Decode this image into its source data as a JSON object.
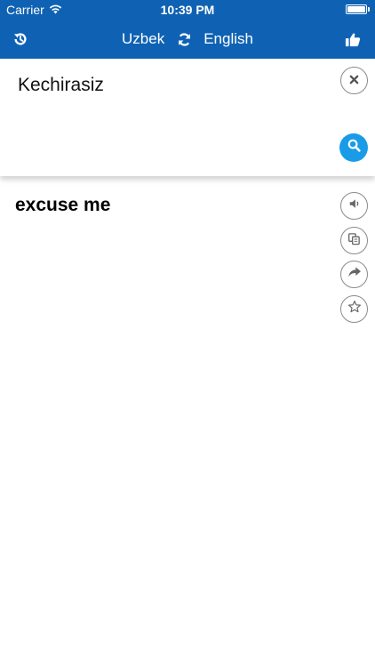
{
  "status_bar": {
    "carrier": "Carrier",
    "time": "10:39 PM",
    "icons": [
      "wifi-icon",
      "battery-icon"
    ]
  },
  "nav": {
    "history_icon": "history-icon",
    "source_language": "Uzbek",
    "swap_icon": "swap-refresh-icon",
    "target_language": "English",
    "like_icon": "thumbs-up-icon",
    "background_color": "#0f62b3"
  },
  "input": {
    "value": "Kechirasiz",
    "clear_icon": "close-icon",
    "search_icon": "search-icon",
    "search_button_color": "#1a9be8"
  },
  "result": {
    "text": "excuse me",
    "actions": [
      "speaker-icon",
      "copy-icon",
      "share-icon",
      "star-icon"
    ]
  }
}
